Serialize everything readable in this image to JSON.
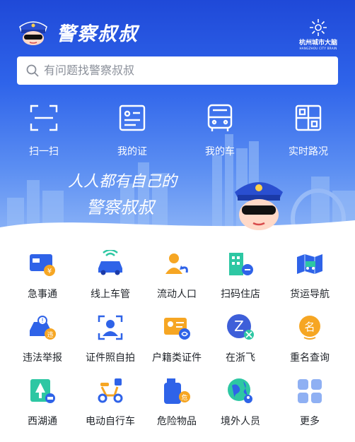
{
  "app": {
    "title": "警察叔叔",
    "brand_cn": "杭州城市大脑",
    "brand_en": "HANGZHOU CITY BRAIN"
  },
  "search": {
    "placeholder": "有问题找警察叔叔"
  },
  "quick_actions": [
    {
      "label": "扫一扫",
      "icon": "scan-icon"
    },
    {
      "label": "我的证",
      "icon": "id-card-icon"
    },
    {
      "label": "我的车",
      "icon": "car-icon"
    },
    {
      "label": "实时路况",
      "icon": "traffic-map-icon"
    }
  ],
  "banner": {
    "slogan_line1": "人人都有自己的",
    "slogan_line2": "警察叔叔"
  },
  "services": [
    {
      "label": "急事通",
      "icon": "urgent-card-icon"
    },
    {
      "label": "线上车管",
      "icon": "online-vehicle-icon"
    },
    {
      "label": "流动人口",
      "icon": "floating-population-icon"
    },
    {
      "label": "扫码住店",
      "icon": "hotel-scan-icon"
    },
    {
      "label": "货运导航",
      "icon": "freight-navigation-icon"
    },
    {
      "label": "违法举报",
      "icon": "violation-report-icon"
    },
    {
      "label": "证件照自拍",
      "icon": "id-photo-icon"
    },
    {
      "label": "户籍类证件",
      "icon": "household-register-icon"
    },
    {
      "label": "在浙飞",
      "icon": "drone-icon"
    },
    {
      "label": "重名查询",
      "icon": "name-query-icon"
    },
    {
      "label": "西湖通",
      "icon": "west-lake-icon"
    },
    {
      "label": "电动自行车",
      "icon": "e-bike-icon"
    },
    {
      "label": "危险物品",
      "icon": "hazardous-goods-icon"
    },
    {
      "label": "境外人员",
      "icon": "foreigner-icon"
    },
    {
      "label": "更多",
      "icon": "more-icon"
    }
  ],
  "colors": {
    "primary": "#2a5ae6",
    "accent_orange": "#f6a623",
    "text": "#1f2329"
  }
}
